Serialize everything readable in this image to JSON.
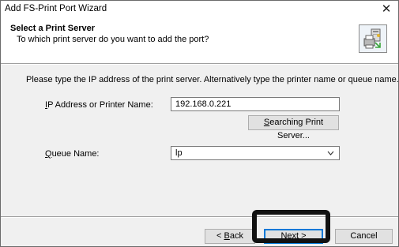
{
  "window": {
    "title": "Add FS-Print Port Wizard",
    "close_glyph": "✕"
  },
  "header": {
    "title": "Select a Print Server",
    "subtitle": "To which print server do you want to add the port?",
    "icon": "printer-server-icon"
  },
  "instruction": "Please type the IP address of the print server. Alternatively type the printer name or queue name.",
  "ip_field": {
    "label_prefix": "",
    "label_mnemonic": "I",
    "label_rest": "P Address or Printer Name:",
    "value": "192.168.0.221"
  },
  "search_button": {
    "mnemonic": "S",
    "rest": "earching Print Server..."
  },
  "queue_field": {
    "label_mnemonic": "Q",
    "label_rest": "ueue Name:",
    "value": "lp"
  },
  "buttons": {
    "back_prefix": "< ",
    "back_mnemonic": "B",
    "back_rest": "ack",
    "next_mnemonic": "N",
    "next_rest": "ext >",
    "cancel": "Cancel"
  },
  "colors": {
    "highlight": "#111111",
    "default_button_border": "#0078d7"
  }
}
